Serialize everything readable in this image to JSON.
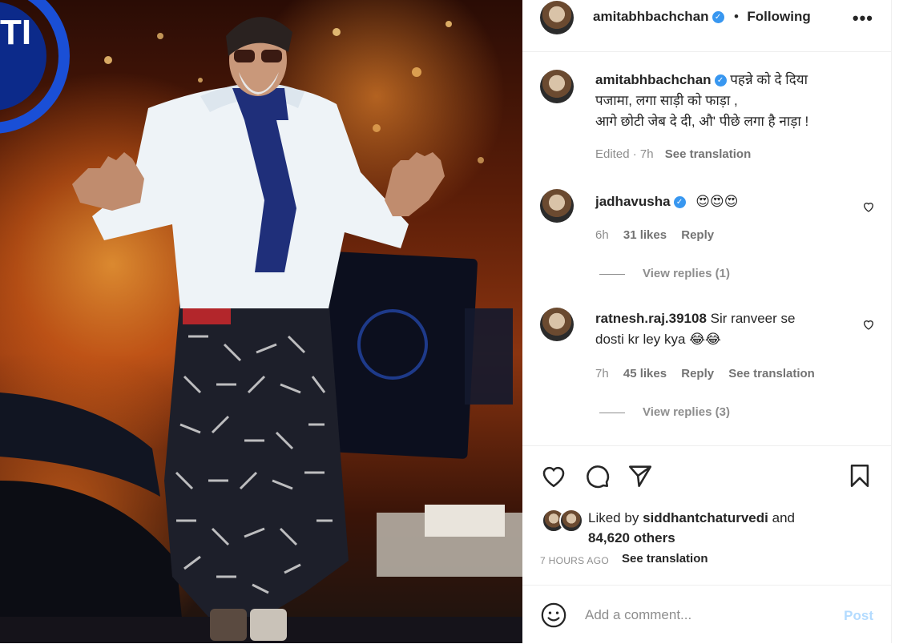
{
  "post": {
    "author": "amitabhbachchan",
    "follow_status": "Following",
    "separator": "•",
    "more_icon": "more-horizontal-icon"
  },
  "photo": {
    "sign_text": "TI"
  },
  "caption": {
    "username": "amitabhbachchan",
    "lines": [
      "पहन्ने को दे दिया",
      "पजामा, लगा साड़ी को फाड़ा ,",
      "आगे छोटी जेब दे दी, औ' पीछे लगा है नाड़ा !"
    ],
    "edited_time": "Edited · 7h",
    "see_translation": "See translation"
  },
  "comments": [
    {
      "username": "jadhavusha",
      "verified": true,
      "text": "😍😍😍",
      "time": "6h",
      "likes": "31 likes",
      "reply": "Reply",
      "view_replies": "View replies (1)"
    },
    {
      "username": "ratnesh.raj.39108",
      "verified": false,
      "text_line1": "Sir ranveer se",
      "text_line2": "dosti kr ley kya 😂😂",
      "time": "7h",
      "likes": "45 likes",
      "reply": "Reply",
      "see_translation": "See translation",
      "view_replies": "View replies (3)"
    }
  ],
  "actions": {
    "like_icon": "heart-icon",
    "comment_icon": "comment-icon",
    "share_icon": "share-icon",
    "save_icon": "bookmark-icon"
  },
  "likes": {
    "prefix": "Liked by",
    "liked_by_user": "siddhantchaturvedi",
    "and": "and",
    "others": "84,620 others"
  },
  "timestamp": "7 HOURS AGO",
  "timestamp_translation": "See translation",
  "add_comment": {
    "placeholder": "Add a comment...",
    "post_label": "Post",
    "emoji_icon": "smiley-icon"
  },
  "colors": {
    "verified": "#3897f0",
    "post_disabled": "#b3dbff",
    "muted_text": "#8e8e8e"
  }
}
